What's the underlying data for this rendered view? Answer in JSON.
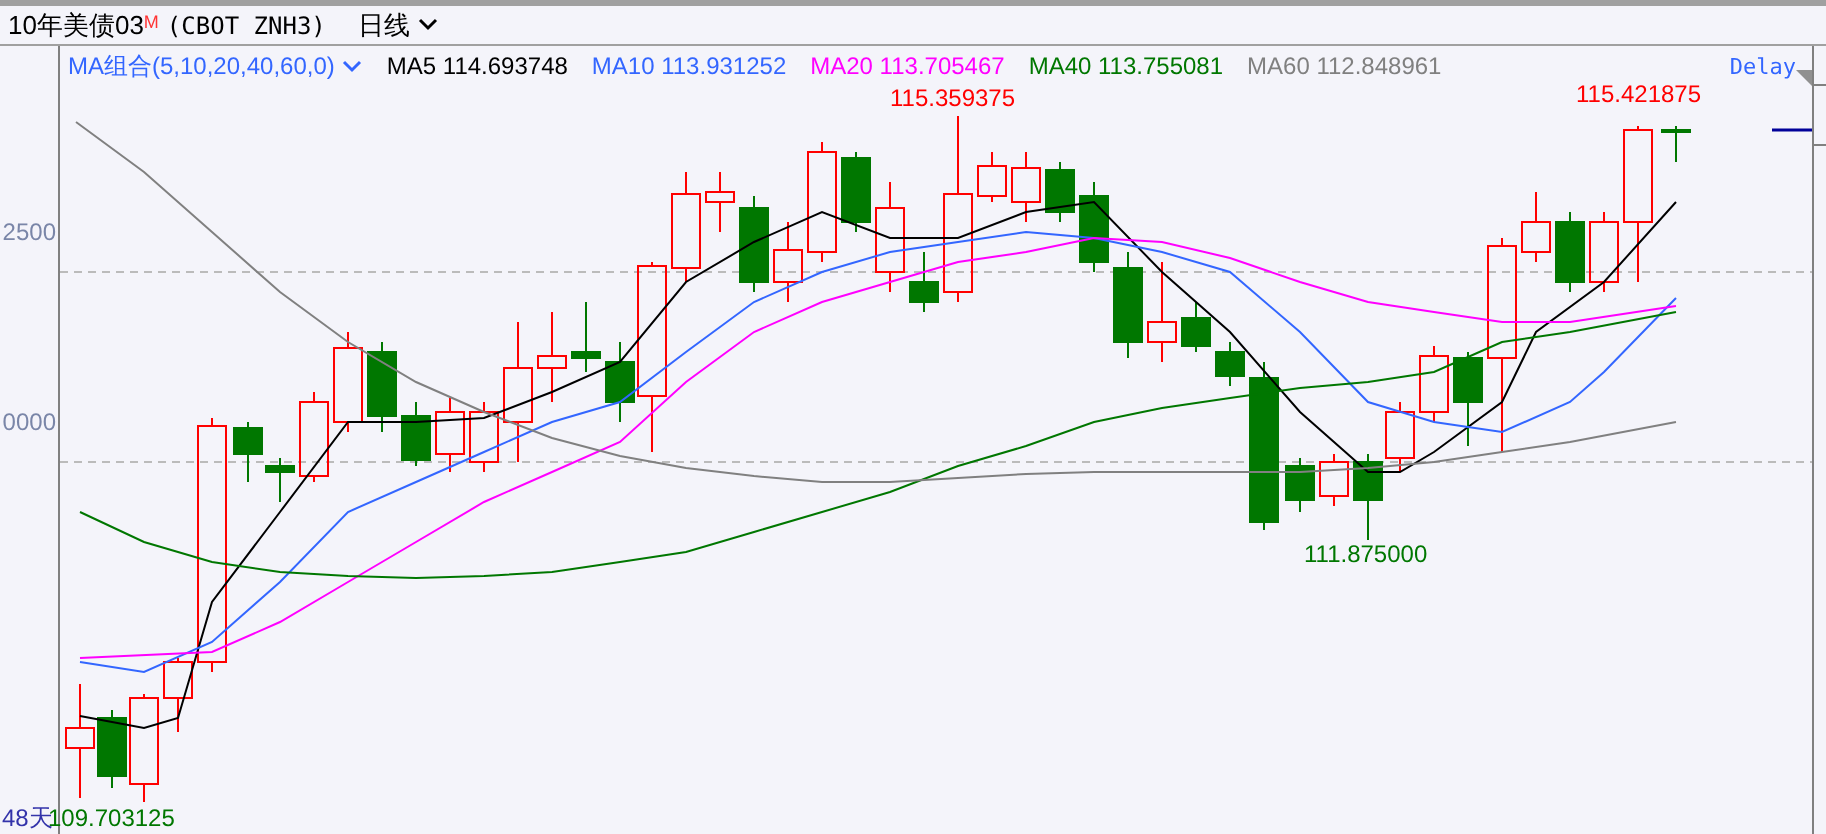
{
  "header": {
    "title": "10年美债03",
    "badge": "M",
    "code": "(CBOT ZNH3)",
    "period": "日线"
  },
  "indicators": {
    "group": "MA组合(5,10,20,40,60,0)",
    "delay": "Delay",
    "items": [
      {
        "label": "MA5 114.693748",
        "color": "#000000"
      },
      {
        "label": "MA10 113.931252",
        "color": "#3366ff"
      },
      {
        "label": "MA20 113.705467",
        "color": "#ff00ff"
      },
      {
        "label": "MA40 113.755081",
        "color": "#007700"
      },
      {
        "label": "MA60 112.848961",
        "color": "#808080"
      }
    ]
  },
  "chart": {
    "y_axis_labels": [
      "2500",
      "0000"
    ],
    "days": "48天",
    "annotations": [
      {
        "text": "115.359375",
        "color": "#ff0000"
      },
      {
        "text": "115.421875",
        "color": "#ff0000"
      },
      {
        "text": "111.875000",
        "color": "#007700"
      },
      {
        "text": "109.703125",
        "color": "#007700"
      }
    ]
  }
}
